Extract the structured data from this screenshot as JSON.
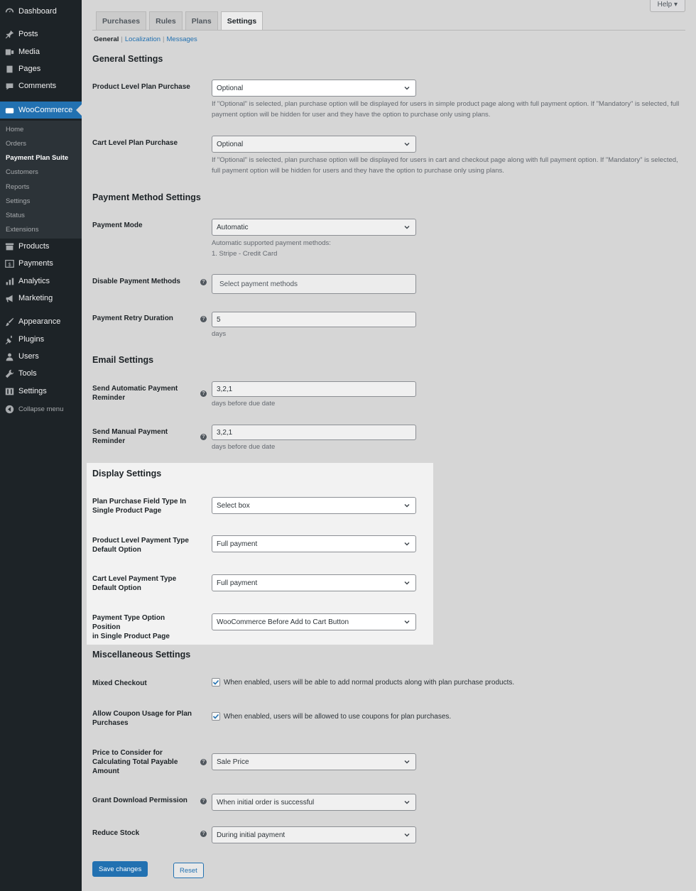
{
  "sidebar": {
    "items": [
      {
        "label": "Dashboard",
        "icon": "dashboard-icon"
      },
      {
        "label": "Posts",
        "icon": "pin-icon"
      },
      {
        "label": "Media",
        "icon": "media-icon"
      },
      {
        "label": "Pages",
        "icon": "pages-icon"
      },
      {
        "label": "Comments",
        "icon": "comments-icon"
      },
      {
        "label": "WooCommerce",
        "icon": "woo-icon"
      },
      {
        "label": "Products",
        "icon": "archive-icon"
      },
      {
        "label": "Payments",
        "icon": "dollar-icon"
      },
      {
        "label": "Analytics",
        "icon": "bar-chart-icon"
      },
      {
        "label": "Marketing",
        "icon": "megaphone-icon"
      },
      {
        "label": "Appearance",
        "icon": "brush-icon"
      },
      {
        "label": "Plugins",
        "icon": "plug-icon"
      },
      {
        "label": "Users",
        "icon": "user-icon"
      },
      {
        "label": "Tools",
        "icon": "wrench-icon"
      },
      {
        "label": "Settings",
        "icon": "sliders-icon"
      }
    ],
    "woo_submenu": [
      "Home",
      "Orders",
      "Payment Plan Suite",
      "Customers",
      "Reports",
      "Settings",
      "Status",
      "Extensions"
    ],
    "collapse_label": "Collapse menu"
  },
  "header": {
    "help_label": "Help ▾",
    "tabs": [
      "Purchases",
      "Rules",
      "Plans",
      "Settings"
    ],
    "subnav": {
      "current": "General",
      "links": [
        "Localization",
        "Messages"
      ],
      "separator": "|"
    }
  },
  "sections": {
    "general": "General Settings",
    "payment": "Payment Method Settings",
    "email": "Email Settings",
    "display": "Display Settings",
    "misc": "Miscellaneous Settings"
  },
  "fields": {
    "product_level": {
      "label": "Product Level Plan Purchase",
      "value": "Optional",
      "desc": "If \"Optional\" is selected, plan purchase option will be displayed for users in simple product page along with full payment option. If \"Mandatory\" is selected, full payment option will be hidden for user and they have the option to purchase only using plans."
    },
    "cart_level": {
      "label": "Cart Level Plan Purchase",
      "value": "Optional",
      "desc": "If \"Optional\" is selected, plan purchase option will be displayed for users in cart and checkout page along with full payment option. If \"Mandatory\" is selected, full payment option will be hidden for users and they have the option to purchase only using plans."
    },
    "payment_mode": {
      "label": "Payment Mode",
      "value": "Automatic",
      "desc1": "Automatic supported payment methods:",
      "desc2": "1. Stripe - Credit Card"
    },
    "disable_methods": {
      "label": "Disable Payment Methods",
      "placeholder": "Select payment methods"
    },
    "retry_duration": {
      "label": "Payment Retry Duration",
      "value": "5",
      "desc": "days"
    },
    "auto_reminder": {
      "label1": "Send Automatic Payment",
      "label2": "Reminder",
      "value": "3,2,1",
      "desc": "days before due date"
    },
    "manual_reminder": {
      "label1": "Send Manual Payment",
      "label2": "Reminder",
      "value": "3,2,1",
      "desc": "days before due date"
    },
    "field_type": {
      "label1": "Plan Purchase Field Type In",
      "label2": "Single Product Page",
      "value": "Select box"
    },
    "product_default": {
      "label1": "Product Level Payment Type",
      "label2": "Default Option",
      "value": "Full payment"
    },
    "cart_default": {
      "label1": "Cart Level Payment Type",
      "label2": "Default Option",
      "value": "Full payment"
    },
    "option_position": {
      "label1": "Payment Type Option Position",
      "label2": "in Single Product Page",
      "value": "WooCommerce Before Add to Cart Button"
    },
    "mixed_checkout": {
      "label": "Mixed Checkout",
      "checked": true,
      "text": "When enabled, users will be able to add normal products along with plan purchase products."
    },
    "coupon": {
      "label1": "Allow Coupon Usage for Plan",
      "label2": "Purchases",
      "checked": true,
      "text": "When enabled, users will be allowed to use coupons for plan purchases."
    },
    "price_consider": {
      "label1": "Price to Consider for",
      "label2": "Calculating Total Payable",
      "label3": "Amount",
      "value": "Sale Price"
    },
    "download_perm": {
      "label": "Grant Download Permission",
      "value": "When initial order is successful"
    },
    "reduce_stock": {
      "label": "Reduce Stock",
      "value": "During initial payment"
    }
  },
  "buttons": {
    "save": "Save changes",
    "reset": "Reset"
  },
  "tooltip_glyph": "?"
}
